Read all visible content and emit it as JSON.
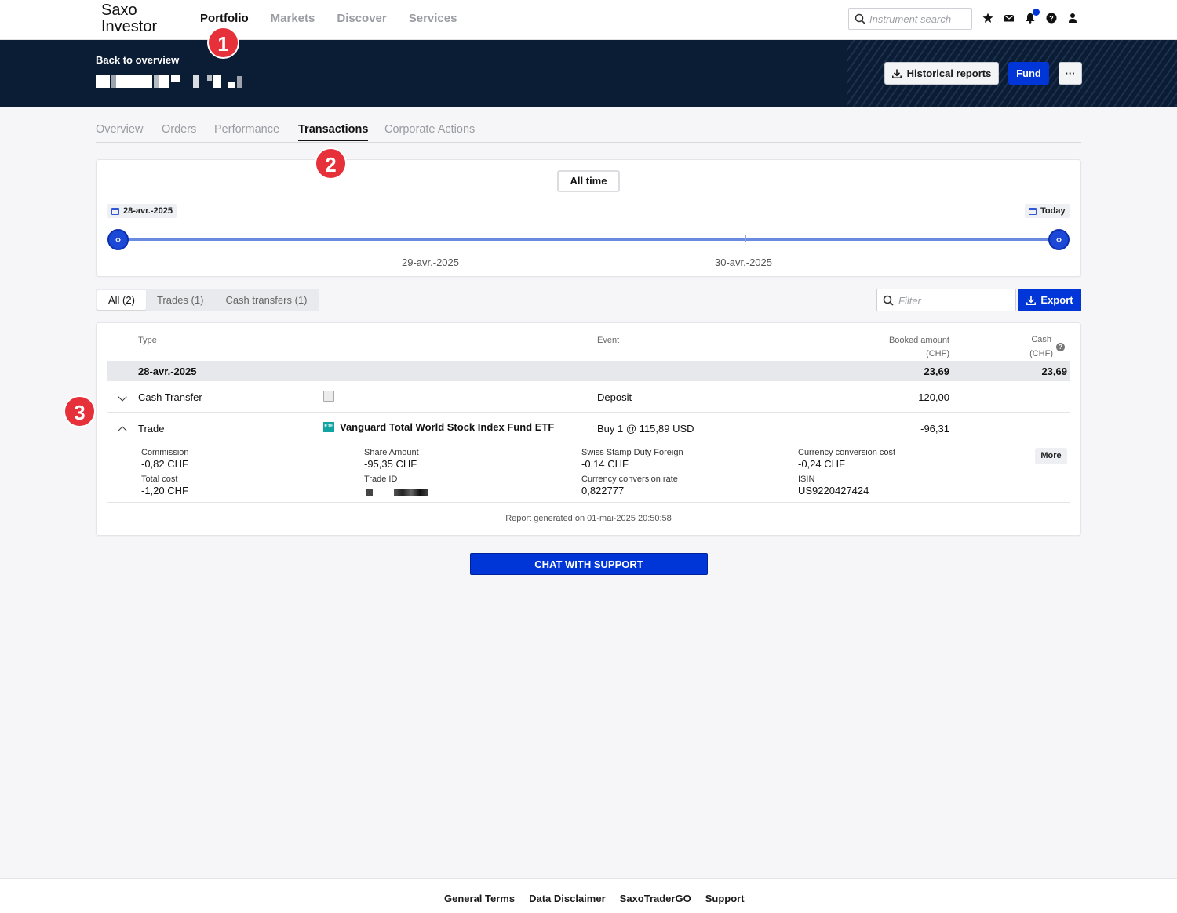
{
  "app": {
    "logo_line1": "Saxo",
    "logo_line2": "Investor"
  },
  "nav": {
    "items": [
      "Portfolio",
      "Markets",
      "Discover",
      "Services"
    ],
    "active": "Portfolio"
  },
  "search": {
    "placeholder": "Instrument search"
  },
  "banner": {
    "back_label": "Back to overview",
    "historical_reports_label": "Historical reports",
    "fund_label": "Fund",
    "more_label": "···"
  },
  "subtabs": [
    "Overview",
    "Orders",
    "Performance",
    "Transactions",
    "Corporate Actions"
  ],
  "markers": [
    "1",
    "2",
    "3"
  ],
  "range": {
    "preset_label": "All time",
    "start_label": "28-avr.-2025",
    "end_label": "Today",
    "ticks": [
      "29-avr.-2025",
      "30-avr.-2025"
    ]
  },
  "filters": {
    "segments": [
      "All (2)",
      "Trades (1)",
      "Cash transfers (1)"
    ],
    "active_segment": "All (2)",
    "filter_placeholder": "Filter",
    "export_label": "Export"
  },
  "table": {
    "headers": {
      "type": "Type",
      "event": "Event",
      "booked_amount": "Booked amount",
      "booked_unit": "(CHF)",
      "cash": "Cash",
      "cash_unit": "(CHF)"
    },
    "group": {
      "date": "28-avr.-2025",
      "booked_total": "23,69",
      "cash_total": "23,69"
    },
    "rows": [
      {
        "type": "Cash Transfer",
        "instrument": "",
        "event": "Deposit",
        "booked": "120,00",
        "expanded": false
      },
      {
        "type": "Trade",
        "instrument": "Vanguard Total World Stock Index Fund ETF",
        "instrument_badge": "ETF",
        "event": "Buy 1 @ 115,89 USD",
        "booked": "-96,31",
        "expanded": true
      }
    ],
    "details": {
      "commission_label": "Commission",
      "commission_value": "-0,82 CHF",
      "total_cost_label": "Total cost",
      "total_cost_value": "-1,20 CHF",
      "share_amount_label": "Share Amount",
      "share_amount_value": "-95,35 CHF",
      "trade_id_label": "Trade ID",
      "stamp_duty_label": "Swiss Stamp Duty Foreign",
      "stamp_duty_value": "-0,14 CHF",
      "conv_rate_label": "Currency conversion rate",
      "conv_rate_value": "0,822777",
      "conv_cost_label": "Currency conversion cost",
      "conv_cost_value": "-0,24 CHF",
      "isin_label": "ISIN",
      "isin_value": "US9220427424",
      "more_label": "More"
    },
    "report_text": "Report generated on 01-mai-2025 20:50:58"
  },
  "chat_label": "CHAT WITH SUPPORT",
  "footer": {
    "links": [
      "General Terms",
      "Data Disclaimer",
      "SaxoTraderGO",
      "Support"
    ]
  },
  "colors": {
    "brand_blue": "#0036d8",
    "banner_navy": "#0b1c35",
    "marker_red": "#e6303a"
  }
}
